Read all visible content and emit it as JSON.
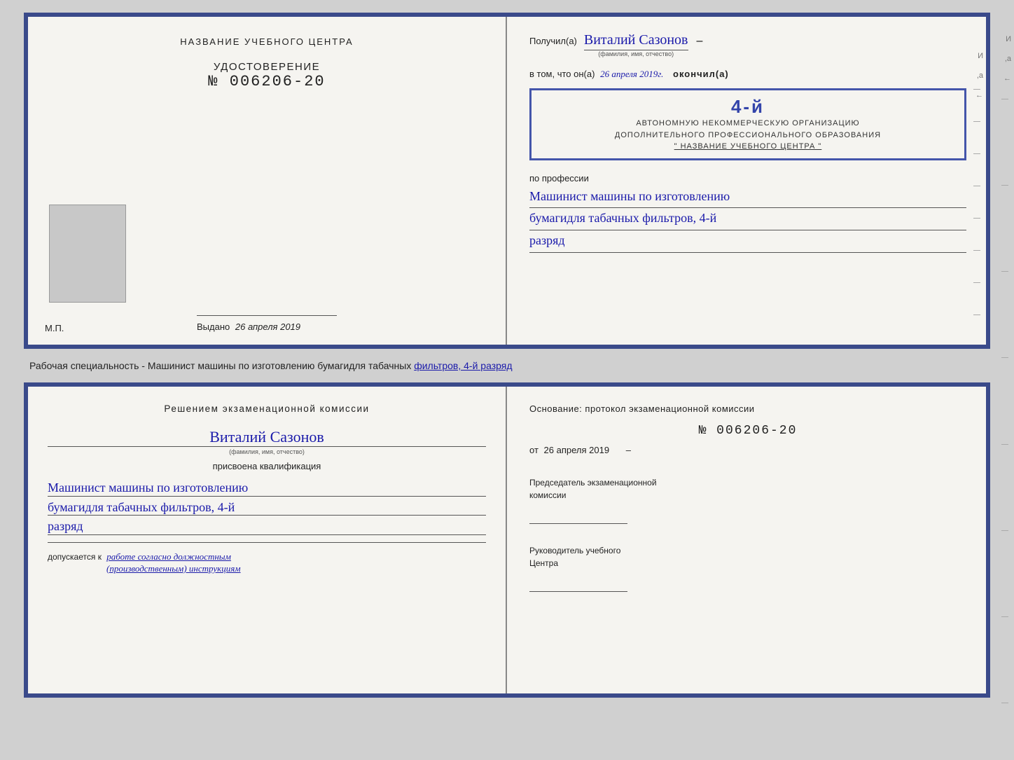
{
  "page": {
    "background_color": "#d0d0d0"
  },
  "cert_top": {
    "left": {
      "title": "НАЗВАНИЕ УЧЕБНОГО ЦЕНТРА",
      "udostoverenie_label": "УДОСТОВЕРЕНИЕ",
      "udostoverenie_number": "№ 006206-20",
      "vydano_label": "Выдано",
      "vydano_date": "26 апреля 2019",
      "mp_label": "М.П."
    },
    "right": {
      "poluchil_prefix": "Получил(а)",
      "recipient_name": "Виталий Сазонов",
      "fio_label": "(фамилия, имя, отчество)",
      "vtom_prefix": "в том, что он(а)",
      "date_handwritten": "26 апреля 2019г.",
      "okonchil_label": "окончил(а)",
      "stamp_number": "4-й",
      "stamp_line1": "АВТОНОМНУЮ НЕКОММЕРЧЕСКУЮ ОРГАНИЗАЦИЮ",
      "stamp_line2": "ДОПОЛНИТЕЛЬНОГО ПРОФЕССИОНАЛЬНОГО ОБРАЗОВАНИЯ",
      "stamp_line3": "\"  НАЗВАНИЕ УЧЕБНОГО ЦЕНТРА  \"",
      "po_professii_label": "по профессии",
      "profession_hw1": "Машинист машины по изготовлению",
      "profession_hw2": "бумагидля табачных фильтров, 4-й",
      "profession_hw3": "разряд"
    }
  },
  "caption": {
    "text_plain": "Рабочая специальность - Машинист машины по изготовлению бумагидля табачных",
    "text_underlined": "фильтров, 4-й разряд"
  },
  "cert_bottom": {
    "left": {
      "resheniyem_label": "Решением  экзаменационной  комиссии",
      "recipient_name": "Виталий Сазонов",
      "fio_label": "(фамилия, имя, отчество)",
      "prisvoena_label": "присвоена квалификация",
      "profession_hw1": "Машинист машины по изготовлению",
      "profession_hw2": "бумагидля табачных фильтров, 4-й",
      "profession_hw3": "разряд",
      "dopuskaetsya_prefix": "допускается к",
      "dopuskaetsya_handwritten": "работе согласно должностным",
      "dopuskaetsya_handwritten2": "(производственным) инструкциям"
    },
    "right": {
      "osnovaniye_label": "Основание:  протокол  экзаменационной  комиссии",
      "protocol_number": "№  006206-20",
      "ot_prefix": "от",
      "ot_date": "26 апреля 2019",
      "predsedatel_label": "Председатель экзаменационной",
      "predsedatel_label2": "комиссии",
      "rukov_label": "Руководитель учебного",
      "rukov_label2": "Центра"
    }
  }
}
